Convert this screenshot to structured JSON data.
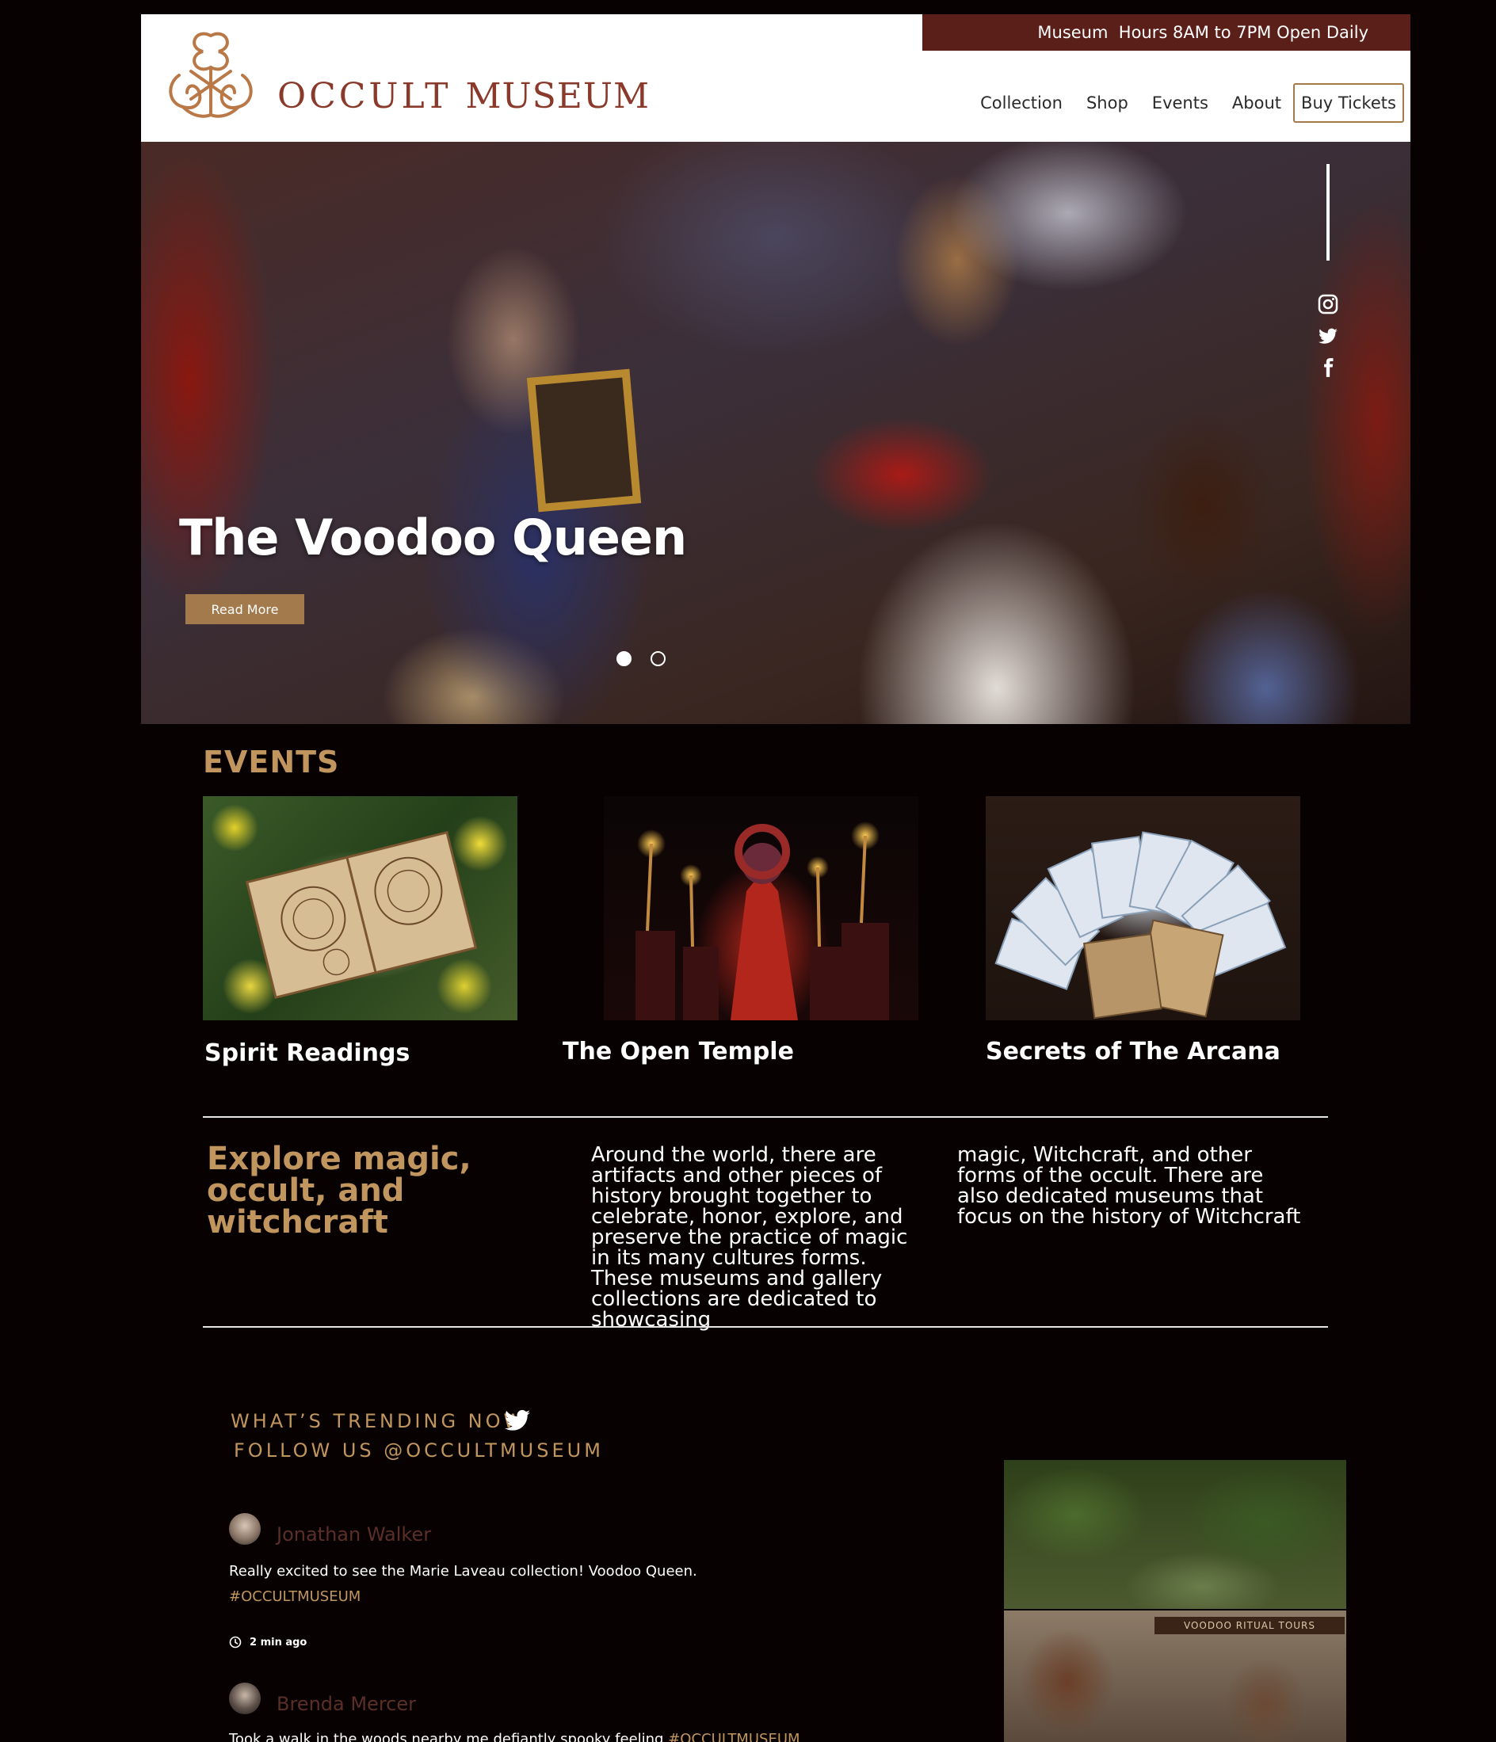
{
  "header": {
    "hours": "Museum  Hours 8AM to 7PM Open Daily",
    "logo_word1": "OCCULT",
    "logo_word2": "MUSEUM",
    "nav": [
      "Collection",
      "Shop",
      "Events",
      "About"
    ],
    "buy_tickets": "Buy Tickets"
  },
  "hero": {
    "title": "The Voodoo Queen",
    "button": "Read More",
    "slides_total": 2,
    "active_slide": 1,
    "social_icons": [
      "instagram-icon",
      "twitter-icon",
      "facebook-icon"
    ]
  },
  "events": {
    "heading": "EVENTS",
    "items": [
      {
        "title": "Spirit Readings"
      },
      {
        "title": "The Open Temple"
      },
      {
        "title": "Secrets of The Arcana"
      }
    ]
  },
  "about": {
    "heading": "Explore magic, occult, and witchcraft",
    "col1": "Around the world, there are artifacts and other pieces of history brought together to celebrate, honor, explore, and preserve the practice of magic in its many cultures forms. These museums and gallery collections are dedicated to showcasing",
    "col2": "magic, Witchcraft, and other forms of the occult. There are also dedicated museums that focus on the history of Witchcraft"
  },
  "trending": {
    "heading": "WHAT’S TRENDING NOW",
    "follow": "FOLLOW US @OCCULTMUSEUM",
    "photo_sign": "VOODOO RITUAL TOURS",
    "tweets": [
      {
        "name": "Jonathan Walker",
        "text": "Really excited to see the Marie Laveau collection! Voodoo Queen.",
        "tag": "#OCCULTMUSEUM",
        "time": "2 min ago"
      },
      {
        "name": "Brenda Mercer",
        "text": "Took a walk in the woods nearby me defiantly spooky feeling ",
        "tag": "#OCCULTMUSEUM"
      }
    ]
  },
  "colors": {
    "gold": "#c0955e",
    "button_gold": "#a27a4b",
    "maroon": "#5a1f19",
    "background": "#070102"
  }
}
